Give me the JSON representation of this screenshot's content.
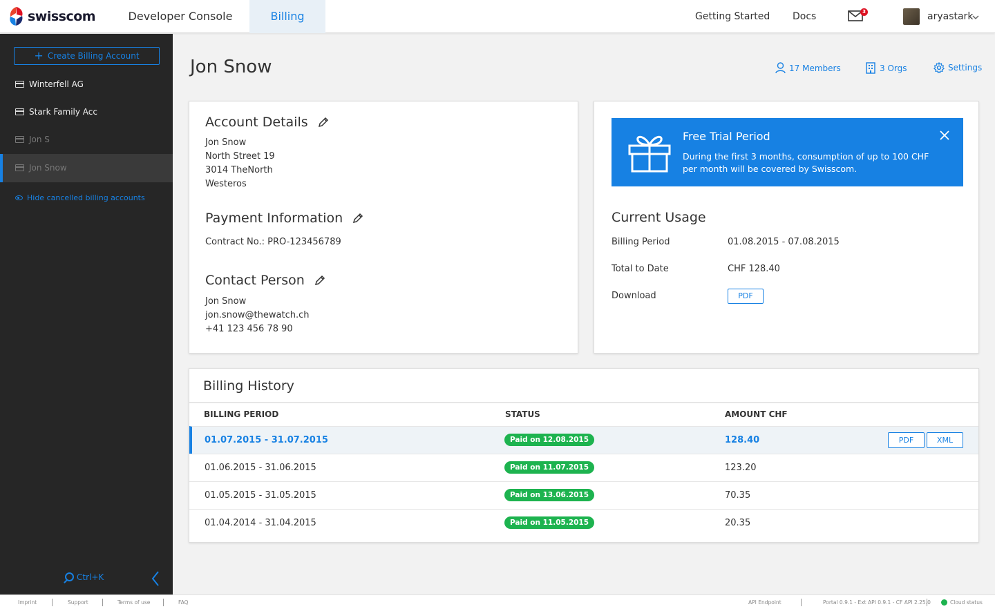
{
  "topbar": {
    "brand": "swisscom",
    "nav": {
      "developer_console": "Developer Console",
      "billing": "Billing"
    },
    "getting_started": "Getting Started",
    "docs": "Docs",
    "mail_count": "3",
    "username": "aryastark"
  },
  "sidebar": {
    "create_label": "Create Billing Account",
    "items": [
      {
        "label": "Winterfell AG",
        "state": "active-account"
      },
      {
        "label": "Stark Family Acc",
        "state": "active-account"
      },
      {
        "label": "Jon S",
        "state": "cancelled"
      },
      {
        "label": "Jon Snow",
        "state": "selected-cancelled"
      }
    ],
    "hide_cancelled": "Hide cancelled billing accounts",
    "search_shortcut": "Ctrl+K"
  },
  "header": {
    "title": "Jon Snow",
    "members": "17 Members",
    "orgs": "3 Orgs",
    "settings": "Settings"
  },
  "account_details": {
    "title": "Account Details",
    "lines": [
      "Jon Snow",
      "North Street 19",
      "3014 TheNorth",
      "Westeros"
    ]
  },
  "payment": {
    "title": "Payment Information",
    "contract": "Contract No.: PRO-123456789"
  },
  "contact": {
    "title": "Contact Person",
    "name": "Jon Snow",
    "email": "jon.snow@thewatch.ch",
    "phone": "+41 123 456 78 90"
  },
  "trial": {
    "title": "Free Trial Period",
    "text": "During the first 3 months, consumption of up to 100 CHF per month will be covered by Swisscom."
  },
  "usage": {
    "title": "Current Usage",
    "billing_period_label": "Billing Period",
    "billing_period_value": "01.08.2015 - 07.08.2015",
    "total_label": "Total to Date",
    "total_value": "CHF 128.40",
    "download_label": "Download",
    "pdf_label": "PDF"
  },
  "history": {
    "title": "Billing History",
    "columns": {
      "period": "BILLING PERIOD",
      "status": "STATUS",
      "amount": "AMOUNT CHF"
    },
    "rows": [
      {
        "period": "01.07.2015 - 31.07.2015",
        "status": "Paid on 12.08.2015",
        "amount": "128.40",
        "pdf": "PDF",
        "xml": "XML"
      },
      {
        "period": "01.06.2015 - 31.06.2015",
        "status": "Paid on 11.07.2015",
        "amount": "123.20"
      },
      {
        "period": "01.05.2015 - 31.05.2015",
        "status": "Paid on 13.06.2015",
        "amount": "70.35"
      },
      {
        "period": "01.04.2014 - 31.04.2015",
        "status": "Paid on 11.05.2015",
        "amount": "20.35"
      }
    ]
  },
  "footer": {
    "imprint": "Imprint",
    "support": "Support",
    "terms": "Terms of use",
    "faq": "FAQ",
    "api_endpoint": "API Endpoint",
    "versions": "Portal 0.9.1 - Ext API 0.9.1 - CF API 2.25.0",
    "cloud_status": "Cloud status"
  },
  "colors": {
    "accent": "#1781e3",
    "sidebar_bg": "#262626",
    "paid_badge": "#1db34f",
    "trial_bg": "#1781e3"
  }
}
